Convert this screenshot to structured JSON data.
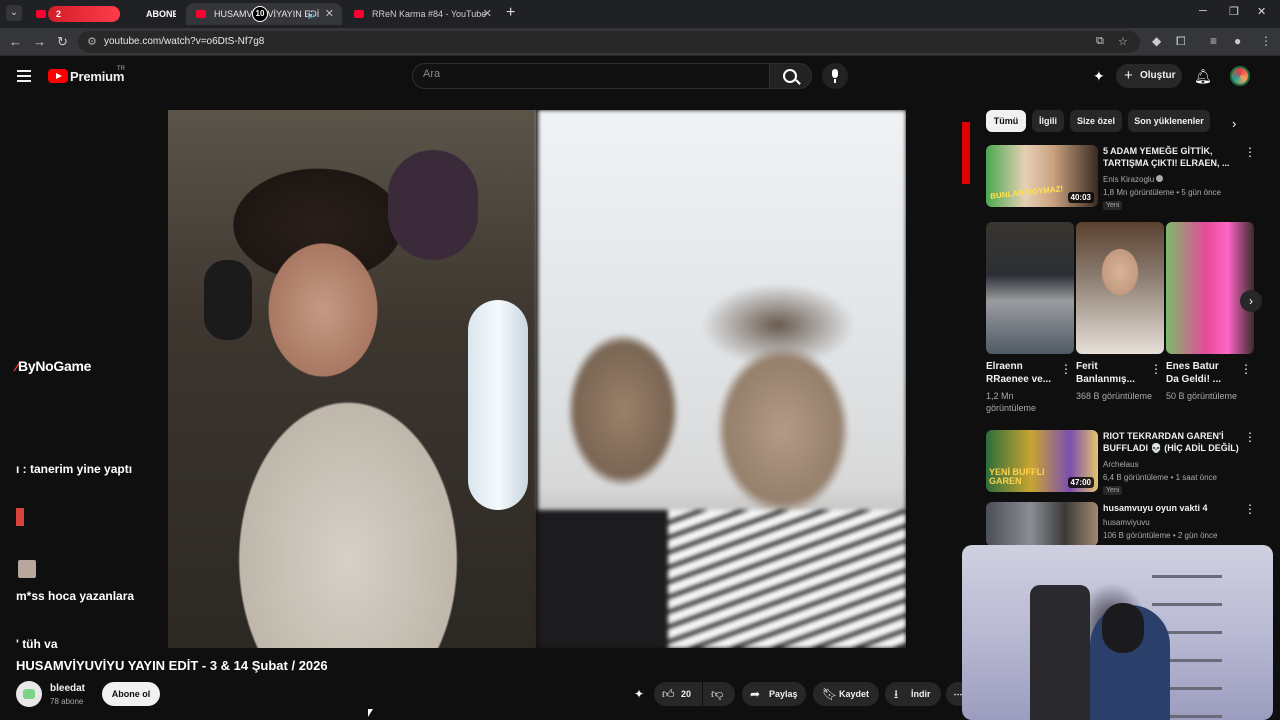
{
  "browser": {
    "tabs": [
      {
        "label": "2",
        "extra": "ABONE"
      },
      {
        "label": "HUSAMVİYUVİ",
        "badge": "10",
        "label_tail": "YAYIN EDİ"
      },
      {
        "label": "RReN Karma #84 - YouTube"
      }
    ],
    "url": "youtube.com/watch?v=o6DtS-Nf7g8"
  },
  "header": {
    "brand": "Premium",
    "country": "TR",
    "search_placeholder": "Ara",
    "create_label": "Oluştur"
  },
  "chat_overlay": {
    "brand": "ByNoGame",
    "lines": [
      "ı : tanerim yine yaptı",
      "m*ss hoca yazanlara",
      "' tüh va"
    ]
  },
  "video": {
    "title": "HUSAMVİYUVİYU YAYIN EDİT - 3 & 14 Şubat / 2026",
    "channel": "bleedat",
    "subscribers": "78 abone",
    "subscribe_label": "Abone ol",
    "likes": "20",
    "share_label": "Paylaş",
    "save_label": "Kaydet",
    "download_label": "İndir"
  },
  "chips": [
    "Tümü",
    "İlgili",
    "Size özel",
    "Son yüklenenler"
  ],
  "recommendations": [
    {
      "title": "5 ADAM YEMEĞE GİTTİK, TARTIŞMA ÇIKTI! ELRAEN, ...",
      "channel": "Enis Kirazoglu",
      "meta": "1,8 Mn görüntüleme • 5 gün önce",
      "badge": "Yeni",
      "duration": "40:03",
      "thumb_text": "BUNLAR DOYMAZ!"
    },
    {
      "title": "RIOT TEKRARDAN GAREN'İ BUFFLADI 💀 (HİÇ ADİL DEĞİL)",
      "channel": "Archelaus",
      "meta": "6,4 B görüntüleme • 1 saat önce",
      "badge": "Yeni",
      "duration": "47:00",
      "thumb_text": "YENİ BUFFLI GAREN"
    },
    {
      "title": "husamvuyu oyun vakti 4",
      "channel": "husamviyuvu",
      "meta": "106 B görüntüleme • 2 gün önce"
    }
  ],
  "shorts": [
    {
      "title": "Elraenn RRaenee ve...",
      "views": "1,2 Mn görüntüleme"
    },
    {
      "title": "Ferit Banlanmış...",
      "views": "368 B görüntüleme"
    },
    {
      "title": "Enes Batur Da Geldi! ...",
      "views": "50 B görüntüleme"
    }
  ],
  "colors": {
    "accent": "#ff0000",
    "background": "#0f0f0f",
    "chip_active": "#f1f1f1"
  }
}
